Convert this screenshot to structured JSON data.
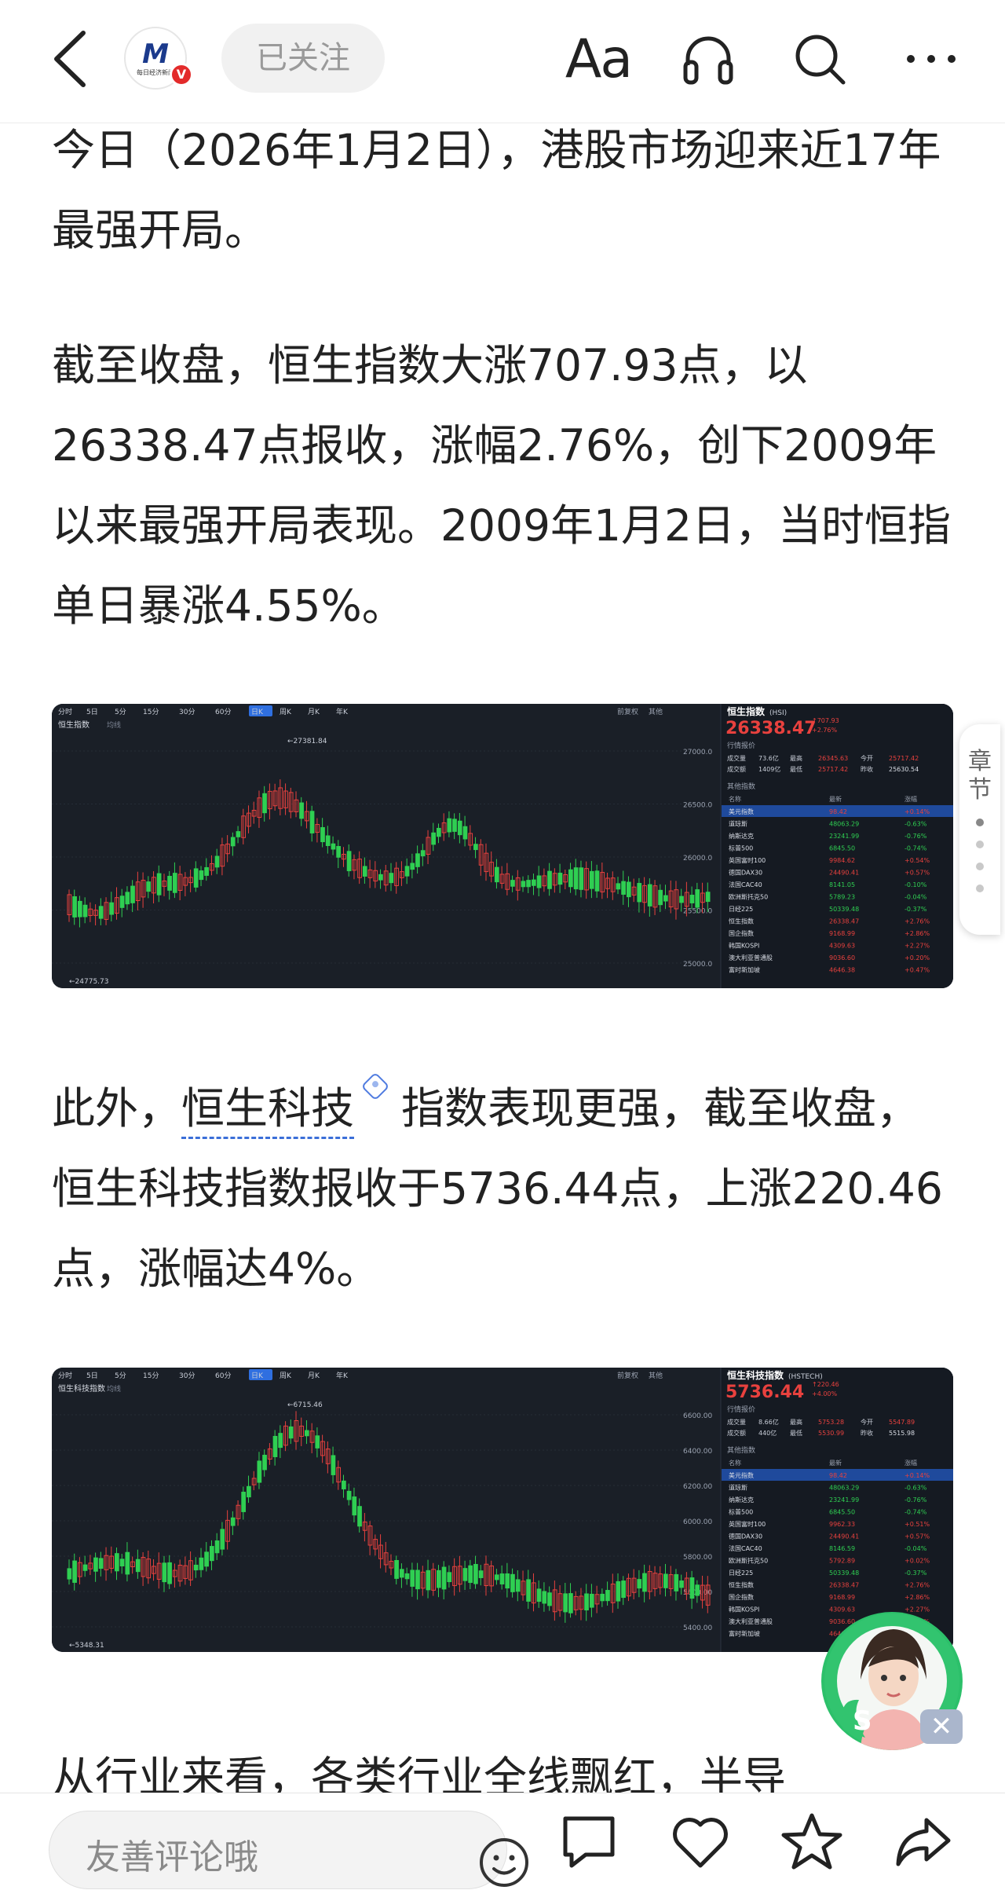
{
  "header": {
    "logo_text": "每日经济新闻",
    "verified_badge": "V",
    "follow_label": "已关注",
    "font_size_label": "Aa",
    "icons": [
      "back-icon",
      "headphones-icon",
      "search-icon",
      "more-icon"
    ]
  },
  "article": {
    "paragraphs": [
      "今日（2026年1月2日），港股市场迎来近17年最强开局。",
      "截至收盘，恒生指数大涨707.93点，以26338.47点报收，涨幅2.76%，创下2009年以来最强开局表现。2009年1月2日，当时恒指单日暴涨4.55%。"
    ],
    "p3_prefix": "此外，",
    "p3_link": "恒生科技",
    "p3_rest": "指数表现更强，截至收盘，恒生科技指数报收于5736.44点，上涨220.46点，涨幅达4%。",
    "p4_partial": "从行业来看，各类行业全线飘红，半导"
  },
  "chart_hsi": {
    "tabs": [
      "分时",
      "5日",
      "5分",
      "15分",
      "30分",
      "60分",
      "日K",
      "周K",
      "月K",
      "年K"
    ],
    "active_tab": "日K",
    "index_name": "恒生指数",
    "index_code": "(HSI)",
    "price": "26338.47",
    "change": "707.93",
    "change_pct": "+2.76%",
    "indicator": "均线",
    "adjust": "前复权",
    "tool": "其他",
    "high_label": "27381.84",
    "low_label": "24775.73",
    "yaxis": [
      "27000.0",
      "26500.0",
      "26000.0",
      "25500.0",
      "25000.0"
    ],
    "quote_title": "行情报价",
    "quote_rows": [
      [
        "成交量",
        "73.6亿",
        "最高",
        "26345.63",
        "今开",
        "25717.42"
      ],
      [
        "成交额",
        "1409亿",
        "最低",
        "25717.42",
        "昨收",
        "25630.54"
      ]
    ],
    "other_title": "其他指数",
    "table_head": [
      "名称",
      "最新",
      "涨幅"
    ],
    "rows": [
      [
        "美元指数",
        "98.42",
        "+0.14%"
      ],
      [
        "道琼斯",
        "48063.29",
        "-0.63%"
      ],
      [
        "纳斯达克",
        "23241.99",
        "-0.76%"
      ],
      [
        "标普500",
        "6845.50",
        "-0.74%"
      ],
      [
        "英国富时100",
        "9984.62",
        "+0.54%"
      ],
      [
        "德国DAX30",
        "24490.41",
        "+0.57%"
      ],
      [
        "法国CAC40",
        "8141.05",
        "-0.10%"
      ],
      [
        "欧洲斯托克50",
        "5789.23",
        "-0.04%"
      ],
      [
        "日经225",
        "50339.48",
        "-0.37%"
      ],
      [
        "恒生指数",
        "26338.47",
        "+2.76%"
      ],
      [
        "国企指数",
        "9168.99",
        "+2.86%"
      ],
      [
        "韩国KOSPI",
        "4309.63",
        "+2.27%"
      ],
      [
        "澳大利亚普通股",
        "9036.60",
        "+0.20%"
      ],
      [
        "富时新加坡",
        "4646.38",
        "+0.47%"
      ]
    ]
  },
  "chart_hstech": {
    "tabs": [
      "分时",
      "5日",
      "5分",
      "15分",
      "30分",
      "60分",
      "日K",
      "周K",
      "月K",
      "年K"
    ],
    "active_tab": "日K",
    "index_name": "恒生科技指数",
    "index_code": "(HSTECH)",
    "price": "5736.44",
    "change": "220.46",
    "change_pct": "+4.00%",
    "indicator": "均线",
    "adjust": "前复权",
    "tool": "其他",
    "high_label": "6715.46",
    "low_label": "5348.31",
    "yaxis": [
      "6600.00",
      "6400.00",
      "6200.00",
      "6000.00",
      "5800.00",
      "5600.00",
      "5400.00"
    ],
    "quote_title": "行情报价",
    "quote_rows": [
      [
        "成交量",
        "8.66亿",
        "最高",
        "5753.28",
        "今开",
        "5547.89"
      ],
      [
        "成交额",
        "440亿",
        "最低",
        "5530.99",
        "昨收",
        "5515.98"
      ]
    ],
    "other_title": "其他指数",
    "table_head": [
      "名称",
      "最新",
      "涨幅"
    ],
    "rows": [
      [
        "美元指数",
        "98.42",
        "+0.14%"
      ],
      [
        "道琼斯",
        "48063.29",
        "-0.63%"
      ],
      [
        "纳斯达克",
        "23241.99",
        "-0.76%"
      ],
      [
        "标普500",
        "6845.50",
        "-0.74%"
      ],
      [
        "英国富时100",
        "9962.33",
        "+0.51%"
      ],
      [
        "德国DAX30",
        "24490.41",
        "+0.57%"
      ],
      [
        "法国CAC40",
        "8146.59",
        "-0.04%"
      ],
      [
        "欧洲斯托克50",
        "5792.89",
        "+0.02%"
      ],
      [
        "日经225",
        "50339.48",
        "-0.37%"
      ],
      [
        "恒生指数",
        "26338.47",
        "+2.76%"
      ],
      [
        "国企指数",
        "9168.99",
        "+2.86%"
      ],
      [
        "韩国KOSPI",
        "4309.63",
        "+2.27%"
      ],
      [
        "澳大利亚普通股",
        "9036.60",
        "+0.20%"
      ],
      [
        "富时新加坡",
        "4646.38",
        "+0.47%"
      ]
    ]
  },
  "chapter_tab": {
    "label": "章节"
  },
  "assistant": {
    "close": "✕"
  },
  "bottom": {
    "comment_placeholder": "友善评论哦",
    "icons": [
      "emoji-icon",
      "comment-icon",
      "like-icon",
      "favorite-icon",
      "share-icon"
    ]
  },
  "colors": {
    "up": "#e8413e",
    "down": "#2fcf52",
    "panel_bg": "#1b2029",
    "link_underline": "#3b6fd8"
  }
}
